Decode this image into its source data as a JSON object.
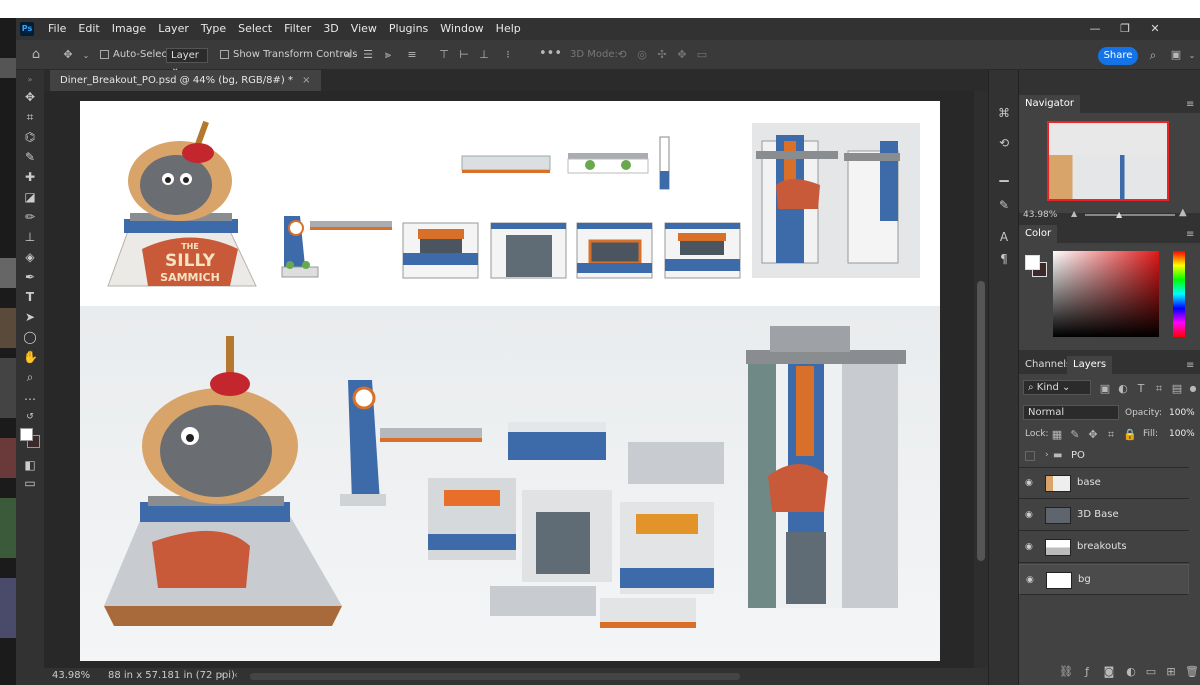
{
  "app": {
    "logo": "Ps"
  },
  "menubar": {
    "items": [
      "File",
      "Edit",
      "Image",
      "Layer",
      "Type",
      "Select",
      "Filter",
      "3D",
      "View",
      "Plugins",
      "Window",
      "Help"
    ]
  },
  "options": {
    "auto_select_label": "Auto-Select:",
    "layer_select": "Layer",
    "show_transform_label": "Show Transform Controls",
    "mode_3d_label": "3D Mode:",
    "share_label": "Share"
  },
  "document": {
    "tab_title": "Diner_Breakout_PO.psd @ 44% (bg, RGB/8#) *",
    "close": "×"
  },
  "status": {
    "zoom": "43.98%",
    "doc_size": "88 in x 57.181 in (72 ppi)"
  },
  "navigator": {
    "title": "Navigator",
    "zoom": "43.98%"
  },
  "color_panel": {
    "title": "Color"
  },
  "layers_panel": {
    "tab_channels": "Channels",
    "tab_layers": "Layers",
    "filter_kind": "Kind",
    "blend_mode": "Normal",
    "opacity_label": "Opacity:",
    "opacity_value": "100%",
    "lock_label": "Lock:",
    "fill_label": "Fill:",
    "fill_value": "100%",
    "layers": [
      {
        "name": "PO",
        "type": "group",
        "visible": false
      },
      {
        "name": "base",
        "type": "pixel",
        "visible": true
      },
      {
        "name": "3D Base",
        "type": "pixel",
        "visible": true
      },
      {
        "name": "breakouts",
        "type": "pixel",
        "visible": true
      },
      {
        "name": "bg",
        "type": "pixel",
        "visible": true,
        "selected": true
      }
    ]
  },
  "artwork": {
    "sign_line1": "THE",
    "sign_line2": "SILLY",
    "sign_line3": "SAMMICH"
  },
  "colors": {
    "accent": "#1473e6",
    "diner_blue": "#3a6aa8",
    "diner_orange": "#d8702a",
    "chrome": "#bfc3c6"
  }
}
